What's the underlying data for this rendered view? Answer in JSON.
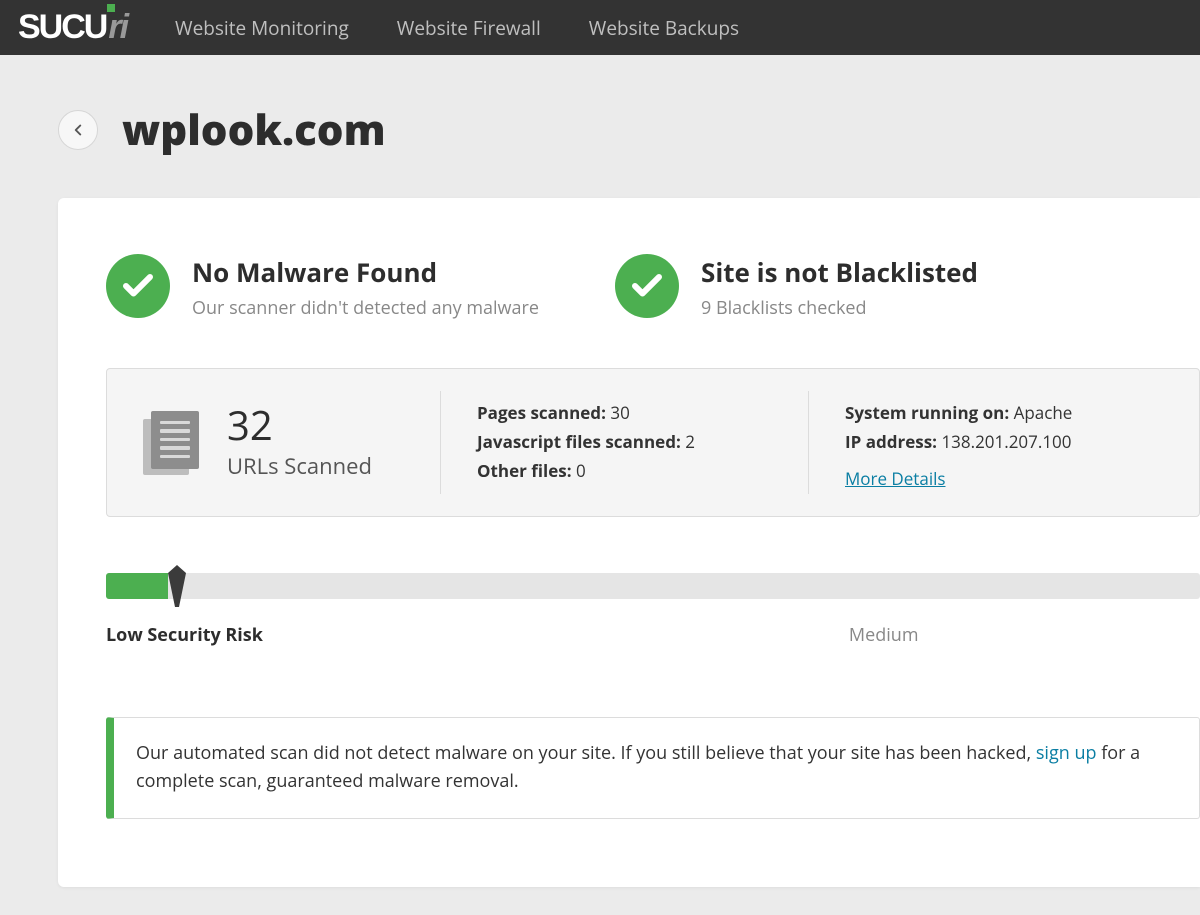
{
  "nav": {
    "links": [
      "Website Monitoring",
      "Website Firewall",
      "Website Backups"
    ]
  },
  "page": {
    "site_title": "wplook.com"
  },
  "status": {
    "malware": {
      "title": "No Malware Found",
      "sub": "Our scanner didn't detected any malware"
    },
    "blacklist": {
      "title": "Site is not Blacklisted",
      "sub": "9 Blacklists checked"
    }
  },
  "stats": {
    "urls_scanned_count": "32",
    "urls_scanned_label": "URLs Scanned",
    "pages_scanned_label": "Pages scanned:",
    "pages_scanned_value": "30",
    "js_scanned_label": "Javascript files scanned:",
    "js_scanned_value": "2",
    "other_files_label": "Other files:",
    "other_files_value": "0",
    "system_label": "System running on:",
    "system_value": "Apache",
    "ip_label": "IP address:",
    "ip_value": "138.201.207.100",
    "more_details": "More Details"
  },
  "risk": {
    "low_label": "Low Security Risk",
    "medium_label": "Medium"
  },
  "callout": {
    "text_before": "Our automated scan did not detect malware on your site. If you still believe that your site has been hacked, ",
    "signup_link": "sign up",
    "text_after": " for a complete scan, guaranteed malware removal."
  }
}
